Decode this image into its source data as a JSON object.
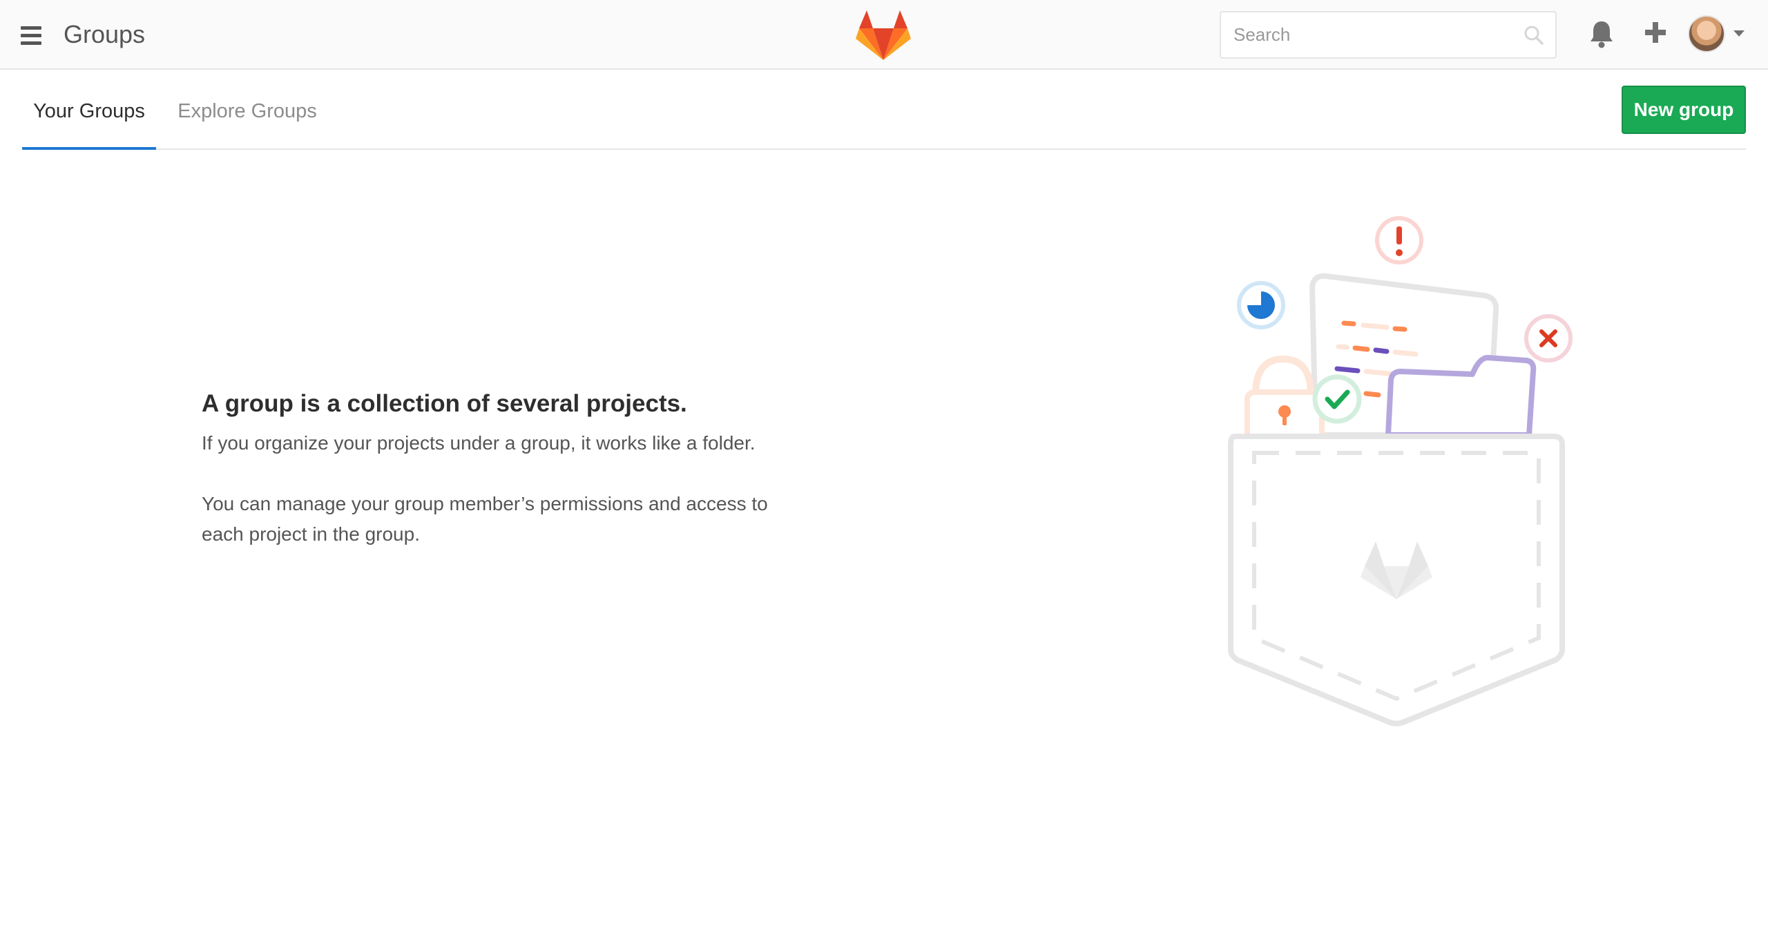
{
  "header": {
    "title": "Groups",
    "search_placeholder": "Search"
  },
  "tabs": [
    {
      "label": "Your Groups",
      "active": true
    },
    {
      "label": "Explore Groups",
      "active": false
    }
  ],
  "actions": {
    "new_group_label": "New group"
  },
  "empty_state": {
    "title": "A group is a collection of several projects.",
    "paragraph1": "If you organize your projects under a group, it works like a folder.",
    "paragraph2": "You can manage your group member’s permissions and access to each project in the group."
  },
  "colors": {
    "accent_tab": "#1f78d1",
    "primary_button": "#1aaa55",
    "header_bg": "#fafafa"
  },
  "icons": [
    "hamburger-icon",
    "gitlab-logo",
    "search-icon",
    "bell-icon",
    "plus-icon",
    "avatar",
    "chevron-down-icon"
  ]
}
